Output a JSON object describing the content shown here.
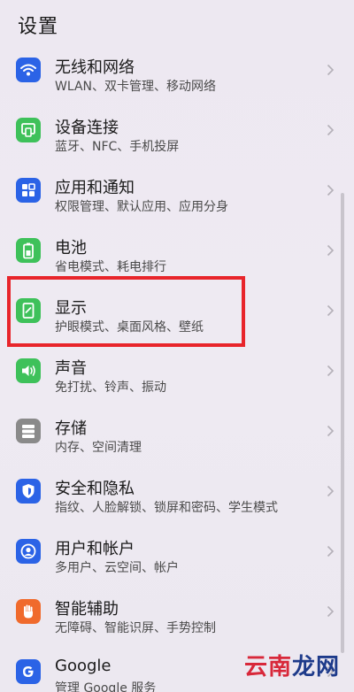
{
  "header": {
    "title": "设置"
  },
  "items": [
    {
      "title": "无线和网络",
      "subtitle": "WLAN、双卡管理、移动网络",
      "icon": "wifi-icon",
      "color": "#2b63e6"
    },
    {
      "title": "设备连接",
      "subtitle": "蓝牙、NFC、手机投屏",
      "icon": "device-connection-icon",
      "color": "#3ec15a"
    },
    {
      "title": "应用和通知",
      "subtitle": "权限管理、默认应用、应用分身",
      "icon": "apps-icon",
      "color": "#2b63e6"
    },
    {
      "title": "电池",
      "subtitle": "省电模式、耗电排行",
      "icon": "battery-icon",
      "color": "#3ec15a"
    },
    {
      "title": "显示",
      "subtitle": "护眼模式、桌面风格、壁纸",
      "icon": "display-icon",
      "color": "#3ec15a"
    },
    {
      "title": "声音",
      "subtitle": "免打扰、铃声、振动",
      "icon": "sound-icon",
      "color": "#3ec15a"
    },
    {
      "title": "存储",
      "subtitle": "内存、空间清理",
      "icon": "storage-icon",
      "color": "#8a8a8a"
    },
    {
      "title": "安全和隐私",
      "subtitle": "指纹、人脸解锁、锁屏和密码、学生模式",
      "icon": "shield-icon",
      "color": "#2b63e6"
    },
    {
      "title": "用户和帐户",
      "subtitle": "多用户、云空间、帐户",
      "icon": "user-icon",
      "color": "#2b63e6"
    },
    {
      "title": "智能辅助",
      "subtitle": "无障碍、智能识屏、手势控制",
      "icon": "hand-icon",
      "color": "#f06a2c"
    },
    {
      "title": "Google",
      "subtitle": "管理 Google 服务",
      "icon": "google-icon",
      "color": "#2b63e6"
    }
  ],
  "watermark": {
    "part_a": "云南",
    "part_b": "龙网"
  },
  "colors": {
    "highlight": "#e8252b",
    "accent_blue": "#2b63e6",
    "accent_green": "#3ec15a"
  }
}
